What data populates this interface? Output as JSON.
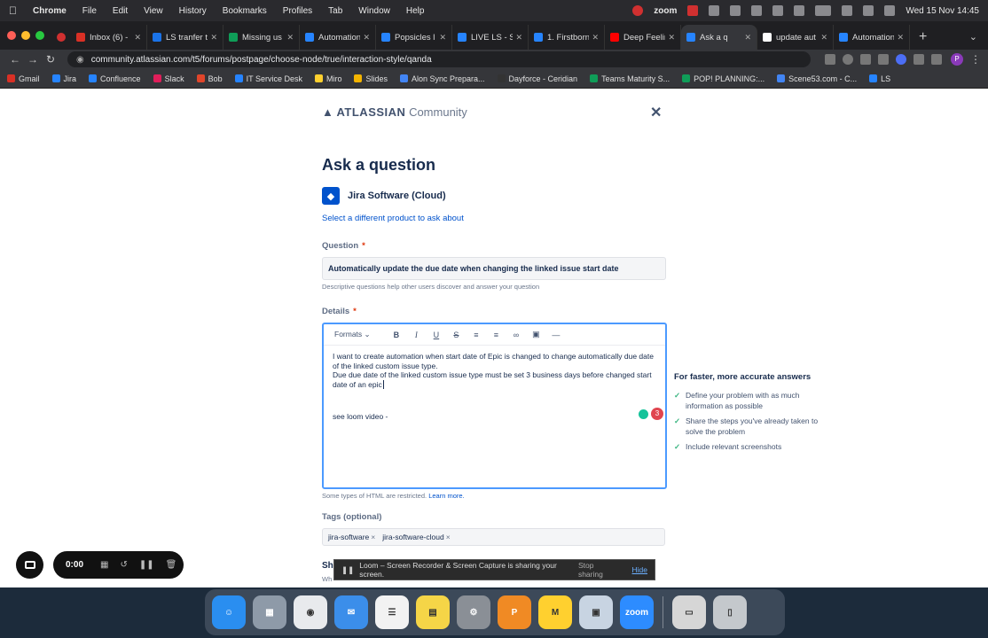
{
  "menubar": {
    "apple": "",
    "items": [
      "Chrome",
      "File",
      "Edit",
      "View",
      "History",
      "Bookmarks",
      "Profiles",
      "Tab",
      "Window",
      "Help"
    ],
    "zoom": "zoom",
    "datetime": "Wed 15 Nov  14:45"
  },
  "tabs": [
    {
      "label": "Inbox (6) -",
      "color": "#d93025"
    },
    {
      "label": "LS tranfer t",
      "color": "#1a73e8"
    },
    {
      "label": "Missing us",
      "color": "#0f9d58"
    },
    {
      "label": "Automation",
      "color": "#2684ff"
    },
    {
      "label": "Popsicles l",
      "color": "#2684ff"
    },
    {
      "label": "LIVE LS - S",
      "color": "#2684ff"
    },
    {
      "label": "1. Firstborn",
      "color": "#2684ff"
    },
    {
      "label": "Deep Feelin",
      "color": "#ff0000"
    },
    {
      "label": "Ask a q",
      "color": "#2684ff",
      "active": true
    },
    {
      "label": "update aut",
      "color": "#ffffff"
    },
    {
      "label": "Automation",
      "color": "#2684ff"
    }
  ],
  "address": {
    "url": "community.atlassian.com/t5/forums/postpage/choose-node/true/interaction-style/qanda",
    "profile_initial": "P"
  },
  "bookmarks": [
    {
      "label": "Gmail",
      "color": "#d93025"
    },
    {
      "label": "Jira",
      "color": "#2684ff"
    },
    {
      "label": "Confluence",
      "color": "#2684ff"
    },
    {
      "label": "Slack",
      "color": "#e01e5a"
    },
    {
      "label": "Bob",
      "color": "#e0452a"
    },
    {
      "label": "IT Service Desk",
      "color": "#2684ff"
    },
    {
      "label": "Miro",
      "color": "#ffd02f"
    },
    {
      "label": "Slides",
      "color": "#f4b400"
    },
    {
      "label": "Alon Sync Prepara...",
      "color": "#4285f4"
    },
    {
      "label": "Dayforce - Ceridian",
      "color": "#333333"
    },
    {
      "label": "Teams Maturity S...",
      "color": "#0f9d58"
    },
    {
      "label": "POP! PLANNING:...",
      "color": "#0f9d58"
    },
    {
      "label": "Scene53.com - C...",
      "color": "#4285f4"
    },
    {
      "label": "LS",
      "color": "#2684ff"
    }
  ],
  "page": {
    "logo_brand": "ATLASSIAN",
    "logo_suffix": "Community",
    "title": "Ask a question",
    "product_name": "Jira Software (Cloud)",
    "change_product": "Select a different product to ask about",
    "question_label": "Question",
    "required_mark": "*",
    "question_value": "Automatically update the due date when changing the linked issue start date",
    "question_help": "Descriptive questions help other users discover and answer your question",
    "details_label": "Details",
    "formats": "Formats",
    "details_lines": [
      "I want to create automation when start date of Epic is changed to change automatically due date of the linked custom issue type.",
      "Due due date of the linked custom issue type must be set 3 business days before changed start date of an epic",
      "see loom video -"
    ],
    "grammarly_count": "3",
    "html_note": "Some types of HTML are restricted.",
    "learn_more": "Learn more.",
    "tags_label": "Tags (optional)",
    "tags": [
      "jira-software",
      "jira-software-cloud"
    ],
    "share_fragment": "Sh",
    "share_fragment2": "Wh"
  },
  "tips": {
    "title": "For faster, more accurate answers",
    "items": [
      "Define your problem with as much information as possible",
      "Share the steps you've already taken to solve the problem",
      "Include relevant screenshots"
    ]
  },
  "loom": {
    "timer": "0:00",
    "share_text": "Loom – Screen Recorder & Screen Capture is sharing your screen.",
    "stop_sharing": "Stop sharing",
    "hide": "Hide"
  },
  "dock": [
    {
      "name": "finder",
      "color": "#2a8ef0",
      "glyph": "☺"
    },
    {
      "name": "launchpad",
      "color": "#8e9aa8",
      "glyph": "▦"
    },
    {
      "name": "chrome",
      "color": "#e8eaed",
      "glyph": "◉"
    },
    {
      "name": "mail",
      "color": "#3b8eea",
      "glyph": "✉"
    },
    {
      "name": "reminders",
      "color": "#f2f2f2",
      "glyph": "☰"
    },
    {
      "name": "notes",
      "color": "#f5d547",
      "glyph": "▤"
    },
    {
      "name": "system-settings",
      "color": "#8a8f96",
      "glyph": "⚙"
    },
    {
      "name": "pasta",
      "color": "#f08a24",
      "glyph": "P"
    },
    {
      "name": "miro",
      "color": "#ffd02f",
      "glyph": "M"
    },
    {
      "name": "preview",
      "color": "#c8d4e2",
      "glyph": "▣"
    },
    {
      "name": "zoom",
      "color": "#2d8cff",
      "glyph": "zoom"
    },
    {
      "name": "downloads",
      "color": "#d6d6d6",
      "glyph": "▭"
    },
    {
      "name": "trash",
      "color": "#c4c8cc",
      "glyph": "▯"
    }
  ]
}
